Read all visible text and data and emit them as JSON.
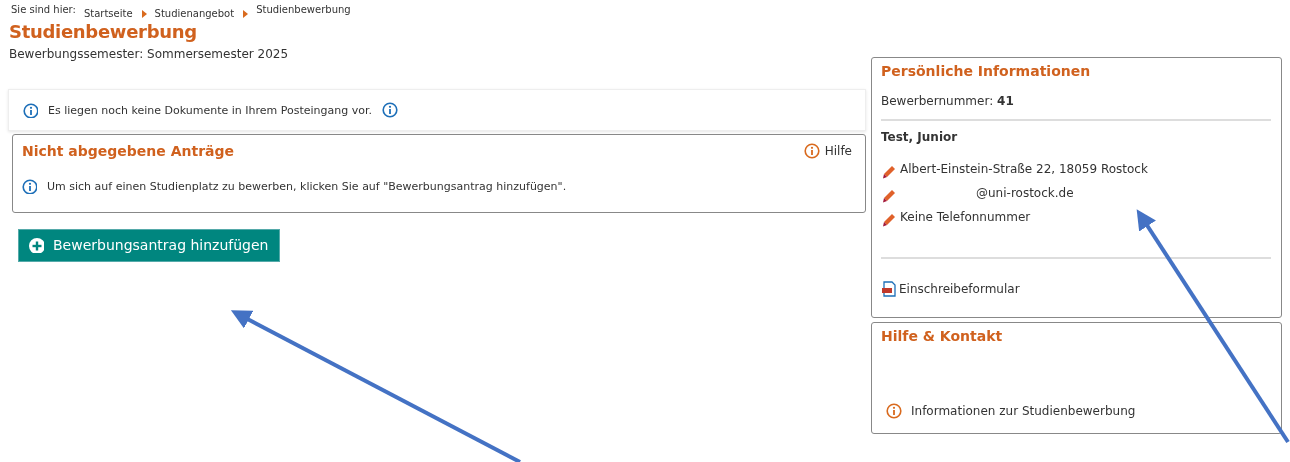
{
  "breadcrumb": {
    "label": "Sie sind hier:",
    "items": [
      {
        "text": "Startseite"
      },
      {
        "text": "Studienangebot"
      },
      {
        "text": "Studienbewerbung"
      }
    ]
  },
  "page_title": "Studienbewerbung",
  "semester": "Bewerbungssemester: Sommersemester 2025",
  "inbox_notice": "Es liegen noch keine Dokumente in Ihrem Posteingang vor.",
  "applications_panel": {
    "title": "Nicht abgegebene Anträge",
    "help": "Hilfe",
    "message": "Um sich auf einen Studienplatz zu bewerben, klicken Sie auf \"Bewerbungsantrag hinzufügen\"."
  },
  "add_button": "Bewerbungsantrag hinzufügen",
  "personal_info": {
    "title": "Persönliche Informationen",
    "applicant_number": "Bewerbernummer: **41**",
    "name": "Test, Junior",
    "contacts": [
      {
        "kind": "address",
        "text": "Albert-Einstein-Straße 22, 18059 Rostock"
      },
      {
        "kind": "email",
        "text": "@uni-rostock.de"
      },
      {
        "kind": "phone",
        "text": "Keine Telefonnummer"
      }
    ],
    "document": "Einschreibeformular"
  },
  "help_contact": {
    "title": "Hilfe & Kontakt",
    "link": "Informationen zur Studienbewerbung"
  }
}
